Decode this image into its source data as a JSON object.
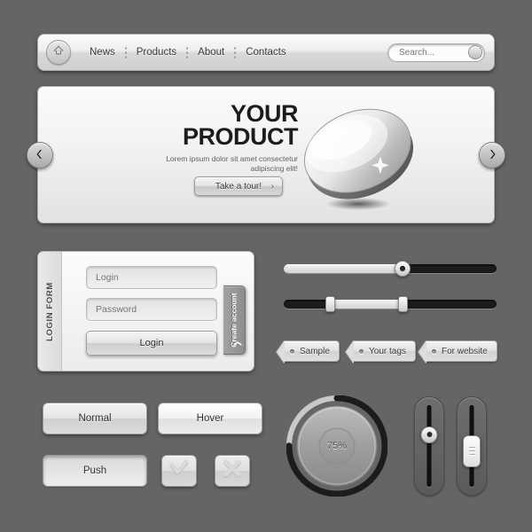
{
  "theme": {
    "background": "#656565",
    "panel_light": "#f2f2f2",
    "panel_dark": "#1c1c1c",
    "text_dark": "#303030",
    "text_muted": "#9a9a9a"
  },
  "navbar": {
    "home_icon": "home-icon",
    "links": [
      {
        "label": "News"
      },
      {
        "label": "Products"
      },
      {
        "label": "About"
      },
      {
        "label": "Contacts"
      }
    ],
    "search": {
      "placeholder": "Search...",
      "value": "",
      "button_icon": "search-circle-icon"
    }
  },
  "hero": {
    "title_line1": "YOUR",
    "title_line2": "PRODUCT",
    "subtitle": "Lorem ipsum dolor sit amet consectetur adipiscing elit!",
    "cta_label": "Take a tour!",
    "cta_chevron": "›",
    "prev_icon": "◄",
    "next_icon": "►",
    "orb_alt": "glossy-3d-ellipse"
  },
  "login_form": {
    "side_label": "LOGIN FORM",
    "login_placeholder": "Login",
    "login_value": "",
    "password_placeholder": "Password",
    "password_value": "",
    "submit_label": "Login",
    "create_account_label": "Create account",
    "create_account_chevron": "❯"
  },
  "sliders": {
    "horizontal": [
      {
        "name": "single-slider",
        "fill_percent": 56,
        "knob_percent": 56,
        "style": "round-knob"
      },
      {
        "name": "range-slider",
        "low_percent": 22,
        "high_percent": 56,
        "style": "dual-rect-knob"
      }
    ],
    "vertical": [
      {
        "name": "vertical-slider-round",
        "value_percent": 62,
        "style": "round-knob"
      },
      {
        "name": "vertical-slider-rect",
        "value_percent": 45,
        "style": "rect-knob"
      }
    ]
  },
  "tags": [
    {
      "label": "Sample"
    },
    {
      "label": "Your tags"
    },
    {
      "label": "For website"
    }
  ],
  "buttons": {
    "normal_label": "Normal",
    "hover_label": "Hover",
    "push_label": "Push",
    "confirm_icon": "check-icon",
    "cancel_icon": "close-icon"
  },
  "progress": {
    "value_label": "75%",
    "value_percent": 75,
    "track_color": "#1c1c1c",
    "dial_color": "#9a9a9a"
  }
}
